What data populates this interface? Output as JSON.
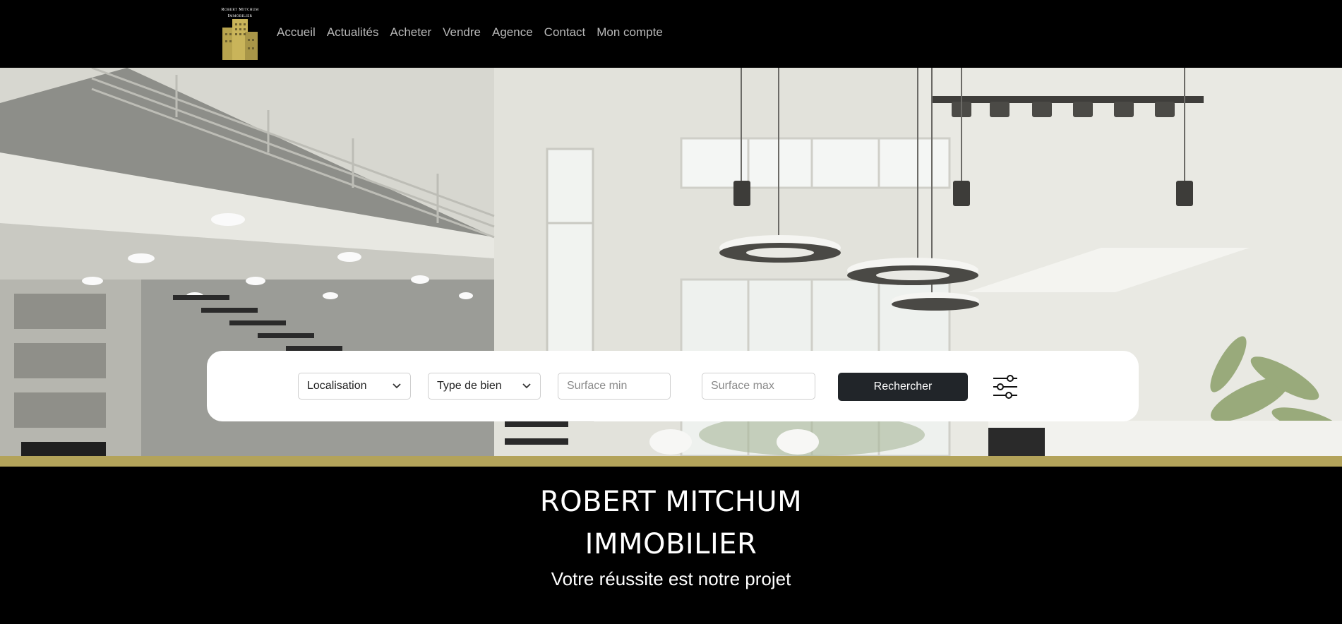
{
  "logo": {
    "line1": "Robert Mitchum",
    "line2": "Immobilier"
  },
  "nav": [
    {
      "label": "Accueil"
    },
    {
      "label": "Actualités"
    },
    {
      "label": "Acheter"
    },
    {
      "label": "Vendre"
    },
    {
      "label": "Agence"
    },
    {
      "label": "Contact"
    },
    {
      "label": "Mon compte"
    }
  ],
  "search": {
    "location_select": "Localisation",
    "type_select": "Type de bien",
    "surface_min_placeholder": "Surface min",
    "surface_max_placeholder": "Surface max",
    "submit_label": "Rechercher",
    "filter_icon": "sliders-icon"
  },
  "brand": {
    "title_line1": "ROBERT MITCHUM",
    "title_line2": "IMMOBILIER",
    "tagline": "Votre réussite est notre projet"
  },
  "colors": {
    "accent": "#b3a35a",
    "button": "#212529",
    "background": "#000000"
  }
}
